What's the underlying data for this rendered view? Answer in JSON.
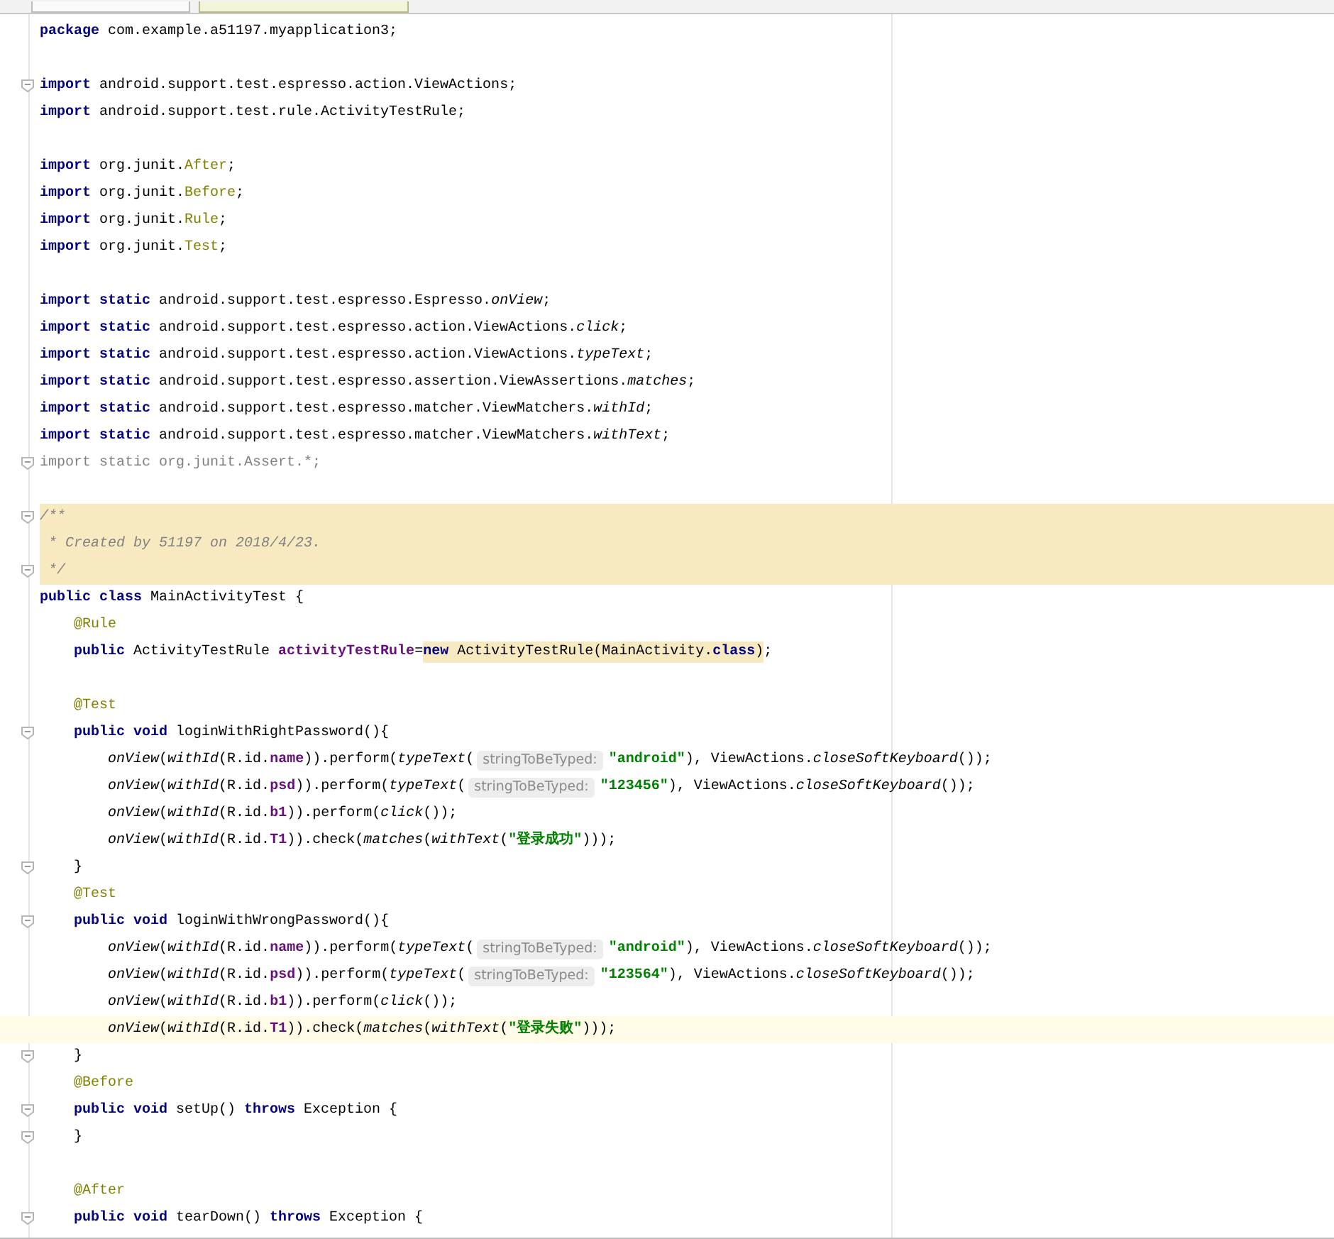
{
  "tabs": [
    {
      "selected": false
    },
    {
      "selected": true
    }
  ],
  "lines": [
    {
      "kind": "code",
      "tokens": [
        {
          "kind": "kw",
          "text": "package"
        },
        {
          "kind": "plain",
          "text": " com.example.a51197.myapplication3;"
        }
      ]
    },
    {
      "kind": "blank"
    },
    {
      "fold": true,
      "tokens": [
        {
          "kind": "kw",
          "text": "import"
        },
        {
          "kind": "plain",
          "text": " android.support.test.espresso.action.ViewActions;"
        }
      ]
    },
    {
      "tokens": [
        {
          "kind": "kw",
          "text": "import"
        },
        {
          "kind": "plain",
          "text": " android.support.test.rule.ActivityTestRule;"
        }
      ]
    },
    {
      "kind": "blank"
    },
    {
      "tokens": [
        {
          "kind": "kw",
          "text": "import"
        },
        {
          "kind": "plain",
          "text": " org.junit."
        },
        {
          "kind": "ann",
          "text": "After"
        },
        {
          "kind": "plain",
          "text": ";"
        }
      ]
    },
    {
      "tokens": [
        {
          "kind": "kw",
          "text": "import"
        },
        {
          "kind": "plain",
          "text": " org.junit."
        },
        {
          "kind": "ann",
          "text": "Before"
        },
        {
          "kind": "plain",
          "text": ";"
        }
      ]
    },
    {
      "tokens": [
        {
          "kind": "kw",
          "text": "import"
        },
        {
          "kind": "plain",
          "text": " org.junit."
        },
        {
          "kind": "ann",
          "text": "Rule"
        },
        {
          "kind": "plain",
          "text": ";"
        }
      ]
    },
    {
      "tokens": [
        {
          "kind": "kw",
          "text": "import"
        },
        {
          "kind": "plain",
          "text": " org.junit."
        },
        {
          "kind": "ann",
          "text": "Test"
        },
        {
          "kind": "plain",
          "text": ";"
        }
      ]
    },
    {
      "kind": "blank"
    },
    {
      "tokens": [
        {
          "kind": "kw",
          "text": "import static"
        },
        {
          "kind": "plain",
          "text": " android.support.test.espresso.Espresso."
        },
        {
          "kind": "static",
          "text": "onView"
        },
        {
          "kind": "plain",
          "text": ";"
        }
      ]
    },
    {
      "tokens": [
        {
          "kind": "kw",
          "text": "import static"
        },
        {
          "kind": "plain",
          "text": " android.support.test.espresso.action.ViewActions."
        },
        {
          "kind": "static",
          "text": "click"
        },
        {
          "kind": "plain",
          "text": ";"
        }
      ]
    },
    {
      "tokens": [
        {
          "kind": "kw",
          "text": "import static"
        },
        {
          "kind": "plain",
          "text": " android.support.test.espresso.action.ViewActions."
        },
        {
          "kind": "static",
          "text": "typeText"
        },
        {
          "kind": "plain",
          "text": ";"
        }
      ]
    },
    {
      "tokens": [
        {
          "kind": "kw",
          "text": "import static"
        },
        {
          "kind": "plain",
          "text": " android.support.test.espresso.assertion.ViewAssertions."
        },
        {
          "kind": "static",
          "text": "matches"
        },
        {
          "kind": "plain",
          "text": ";"
        }
      ]
    },
    {
      "tokens": [
        {
          "kind": "kw",
          "text": "import static"
        },
        {
          "kind": "plain",
          "text": " android.support.test.espresso.matcher.ViewMatchers."
        },
        {
          "kind": "static",
          "text": "withId"
        },
        {
          "kind": "plain",
          "text": ";"
        }
      ]
    },
    {
      "tokens": [
        {
          "kind": "kw",
          "text": "import static"
        },
        {
          "kind": "plain",
          "text": " android.support.test.espresso.matcher.ViewMatchers."
        },
        {
          "kind": "static",
          "text": "withText"
        },
        {
          "kind": "plain",
          "text": ";"
        }
      ]
    },
    {
      "fold": true,
      "tokens": [
        {
          "kind": "unused",
          "text": "import static org.junit.Assert.*;"
        }
      ]
    },
    {
      "kind": "blank"
    },
    {
      "fold": true,
      "kind": "doc",
      "tokens": [
        {
          "kind": "comment",
          "text": "/**"
        }
      ]
    },
    {
      "kind": "doc",
      "tokens": [
        {
          "kind": "comment",
          "text": " * Created by 51197 on 2018/4/23."
        }
      ]
    },
    {
      "fold": true,
      "kind": "doc",
      "tokens": [
        {
          "kind": "comment",
          "text": " */"
        }
      ]
    },
    {
      "tokens": [
        {
          "kind": "kw",
          "text": "public class"
        },
        {
          "kind": "plain",
          "text": " MainActivityTest {"
        }
      ]
    },
    {
      "tokens": [
        {
          "kind": "ann",
          "text": "    @Rule"
        }
      ]
    },
    {
      "tokens": [
        {
          "kind": "kw",
          "text": "    public"
        },
        {
          "kind": "plain",
          "text": " ActivityTestRule "
        },
        {
          "kind": "field",
          "text": "activityTestRule"
        },
        {
          "kind": "plain",
          "text": "="
        },
        {
          "kind": "kw",
          "text": "new",
          "marked": true
        },
        {
          "kind": "plain",
          "text": " ActivityTestRule(MainActivity.",
          "marked": true
        },
        {
          "kind": "kw",
          "text": "class",
          "marked": true
        },
        {
          "kind": "plain",
          "text": ")",
          "marked": true
        },
        {
          "kind": "plain",
          "text": ";"
        }
      ]
    },
    {
      "kind": "blank"
    },
    {
      "tokens": [
        {
          "kind": "ann",
          "text": "    @Test"
        }
      ]
    },
    {
      "fold": true,
      "tokens": [
        {
          "kind": "kw",
          "text": "    public void"
        },
        {
          "kind": "plain",
          "text": " loginWithRightPassword(){"
        }
      ]
    },
    {
      "tokens": [
        {
          "kind": "static",
          "text": "        onView"
        },
        {
          "kind": "plain",
          "text": "("
        },
        {
          "kind": "static",
          "text": "withId"
        },
        {
          "kind": "plain",
          "text": "(R.id."
        },
        {
          "kind": "field",
          "text": "name"
        },
        {
          "kind": "plain",
          "text": ")).perform("
        },
        {
          "kind": "static",
          "text": "typeText"
        },
        {
          "kind": "plain",
          "text": "("
        },
        {
          "kind": "hint",
          "text": "stringToBeTyped:"
        },
        {
          "kind": "str",
          "text": "\"android\""
        },
        {
          "kind": "plain",
          "text": "), ViewActions."
        },
        {
          "kind": "static",
          "text": "closeSoftKeyboard"
        },
        {
          "kind": "plain",
          "text": "());"
        }
      ]
    },
    {
      "tokens": [
        {
          "kind": "static",
          "text": "        onView"
        },
        {
          "kind": "plain",
          "text": "("
        },
        {
          "kind": "static",
          "text": "withId"
        },
        {
          "kind": "plain",
          "text": "(R.id."
        },
        {
          "kind": "field",
          "text": "psd"
        },
        {
          "kind": "plain",
          "text": ")).perform("
        },
        {
          "kind": "static",
          "text": "typeText"
        },
        {
          "kind": "plain",
          "text": "("
        },
        {
          "kind": "hint",
          "text": "stringToBeTyped:"
        },
        {
          "kind": "str",
          "text": "\"123456\""
        },
        {
          "kind": "plain",
          "text": "), ViewActions."
        },
        {
          "kind": "static",
          "text": "closeSoftKeyboard"
        },
        {
          "kind": "plain",
          "text": "());"
        }
      ]
    },
    {
      "tokens": [
        {
          "kind": "static",
          "text": "        onView"
        },
        {
          "kind": "plain",
          "text": "("
        },
        {
          "kind": "static",
          "text": "withId"
        },
        {
          "kind": "plain",
          "text": "(R.id."
        },
        {
          "kind": "field",
          "text": "b1"
        },
        {
          "kind": "plain",
          "text": ")).perform("
        },
        {
          "kind": "static",
          "text": "click"
        },
        {
          "kind": "plain",
          "text": "());"
        }
      ]
    },
    {
      "tokens": [
        {
          "kind": "static",
          "text": "        onView"
        },
        {
          "kind": "plain",
          "text": "("
        },
        {
          "kind": "static",
          "text": "withId"
        },
        {
          "kind": "plain",
          "text": "(R.id."
        },
        {
          "kind": "field",
          "text": "T1"
        },
        {
          "kind": "plain",
          "text": ")).check("
        },
        {
          "kind": "static",
          "text": "matches"
        },
        {
          "kind": "plain",
          "text": "("
        },
        {
          "kind": "static",
          "text": "withText"
        },
        {
          "kind": "plain",
          "text": "("
        },
        {
          "kind": "str",
          "text": "\"登录成功\""
        },
        {
          "kind": "plain",
          "text": ")));"
        }
      ]
    },
    {
      "fold": true,
      "tokens": [
        {
          "kind": "plain",
          "text": "    }"
        }
      ]
    },
    {
      "tokens": [
        {
          "kind": "ann",
          "text": "    @Test"
        }
      ]
    },
    {
      "fold": true,
      "tokens": [
        {
          "kind": "kw",
          "text": "    public void"
        },
        {
          "kind": "plain",
          "text": " loginWithWrongPassword(){"
        }
      ]
    },
    {
      "tokens": [
        {
          "kind": "static",
          "text": "        onView"
        },
        {
          "kind": "plain",
          "text": "("
        },
        {
          "kind": "static",
          "text": "withId"
        },
        {
          "kind": "plain",
          "text": "(R.id."
        },
        {
          "kind": "field",
          "text": "name"
        },
        {
          "kind": "plain",
          "text": ")).perform("
        },
        {
          "kind": "static",
          "text": "typeText"
        },
        {
          "kind": "plain",
          "text": "("
        },
        {
          "kind": "hint",
          "text": "stringToBeTyped:"
        },
        {
          "kind": "str",
          "text": "\"android\""
        },
        {
          "kind": "plain",
          "text": "), ViewActions."
        },
        {
          "kind": "static",
          "text": "closeSoftKeyboard"
        },
        {
          "kind": "plain",
          "text": "());"
        }
      ]
    },
    {
      "tokens": [
        {
          "kind": "static",
          "text": "        onView"
        },
        {
          "kind": "plain",
          "text": "("
        },
        {
          "kind": "static",
          "text": "withId"
        },
        {
          "kind": "plain",
          "text": "(R.id."
        },
        {
          "kind": "field",
          "text": "psd"
        },
        {
          "kind": "plain",
          "text": ")).perform("
        },
        {
          "kind": "static",
          "text": "typeText"
        },
        {
          "kind": "plain",
          "text": "("
        },
        {
          "kind": "hint",
          "text": "stringToBeTyped:"
        },
        {
          "kind": "str",
          "text": "\"123564\""
        },
        {
          "kind": "plain",
          "text": "), ViewActions."
        },
        {
          "kind": "static",
          "text": "closeSoftKeyboard"
        },
        {
          "kind": "plain",
          "text": "());"
        }
      ]
    },
    {
      "tokens": [
        {
          "kind": "static",
          "text": "        onView"
        },
        {
          "kind": "plain",
          "text": "("
        },
        {
          "kind": "static",
          "text": "withId"
        },
        {
          "kind": "plain",
          "text": "(R.id."
        },
        {
          "kind": "field",
          "text": "b1"
        },
        {
          "kind": "plain",
          "text": ")).perform("
        },
        {
          "kind": "static",
          "text": "click"
        },
        {
          "kind": "plain",
          "text": "());"
        }
      ]
    },
    {
      "kind": "current",
      "tokens": [
        {
          "kind": "static",
          "text": "        onView"
        },
        {
          "kind": "plain",
          "text": "("
        },
        {
          "kind": "static",
          "text": "withId"
        },
        {
          "kind": "plain",
          "text": "(R.id."
        },
        {
          "kind": "field",
          "text": "T1"
        },
        {
          "kind": "plain",
          "text": ")).check("
        },
        {
          "kind": "static",
          "text": "matches"
        },
        {
          "kind": "plain",
          "text": "("
        },
        {
          "kind": "static",
          "text": "withText"
        },
        {
          "kind": "plain",
          "text": "("
        },
        {
          "kind": "str",
          "text": "\"登录失败\""
        },
        {
          "kind": "plain",
          "text": ")));"
        }
      ]
    },
    {
      "fold": true,
      "tokens": [
        {
          "kind": "plain",
          "text": "    }"
        }
      ]
    },
    {
      "tokens": [
        {
          "kind": "ann",
          "text": "    @Before"
        }
      ]
    },
    {
      "fold": true,
      "tokens": [
        {
          "kind": "kw",
          "text": "    public void"
        },
        {
          "kind": "plain",
          "text": " setUp() "
        },
        {
          "kind": "kw",
          "text": "throws"
        },
        {
          "kind": "plain",
          "text": " Exception {"
        }
      ]
    },
    {
      "fold": true,
      "tokens": [
        {
          "kind": "plain",
          "text": "    }"
        }
      ]
    },
    {
      "kind": "blank"
    },
    {
      "tokens": [
        {
          "kind": "ann",
          "text": "    @After"
        }
      ]
    },
    {
      "fold": true,
      "tokens": [
        {
          "kind": "kw",
          "text": "    public void"
        },
        {
          "kind": "plain",
          "text": " tearDown() "
        },
        {
          "kind": "kw",
          "text": "throws"
        },
        {
          "kind": "plain",
          "text": " Exception {"
        }
      ]
    }
  ]
}
